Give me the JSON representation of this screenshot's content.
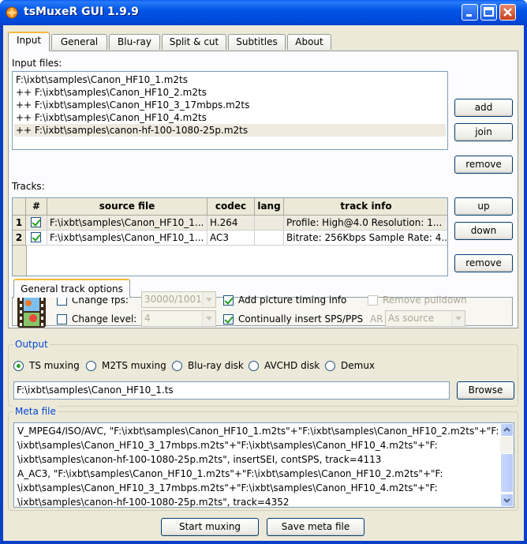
{
  "window": {
    "title": "tsMuxeR GUI 1.9.9"
  },
  "tabs": [
    "Input",
    "General",
    "Blu-ray",
    "Split & cut",
    "Subtitles",
    "About"
  ],
  "input_files": {
    "label": "Input files:",
    "items": [
      "F:\\ixbt\\samples\\Canon_HF10_1.m2ts",
      " ++ F:\\ixbt\\samples\\Canon_HF10_2.m2ts",
      " ++ F:\\ixbt\\samples\\Canon_HF10_3_17mbps.m2ts",
      " ++ F:\\ixbt\\samples\\Canon_HF10_4.m2ts",
      " ++ F:\\ixbt\\samples\\canon-hf-100-1080-25p.m2ts"
    ],
    "buttons": {
      "add": "add",
      "join": "join",
      "remove": "remove"
    }
  },
  "tracks": {
    "label": "Tracks:",
    "columns": [
      "#",
      "source file",
      "codec",
      "lang",
      "track info"
    ],
    "rows": [
      {
        "num": "1",
        "checked": true,
        "source": "F:\\ixbt\\samples\\Canon_HF10_1...",
        "codec": "H.264",
        "lang": "",
        "info": "Profile: High@4.0  Resolution: 1..."
      },
      {
        "num": "2",
        "checked": true,
        "source": "F:\\ixbt\\samples\\Canon_HF10_1...",
        "codec": "AC3",
        "lang": "",
        "info": "Bitrate: 256Kbps Sample Rate: 4..."
      }
    ],
    "buttons": {
      "up": "up",
      "down": "down",
      "remove": "remove"
    }
  },
  "track_options": {
    "tab": "General track options",
    "change_fps": {
      "label": "Change fps:",
      "checked": false,
      "value": "30000/1001"
    },
    "change_level": {
      "label": "Change level:",
      "checked": false,
      "value": "4"
    },
    "add_timing": {
      "label": "Add picture timing info",
      "checked": true
    },
    "insert_sps": {
      "label": "Continually insert SPS/PPS",
      "checked": true
    },
    "remove_pulldown": {
      "label": "Remove pulldown",
      "checked": false
    },
    "ar": {
      "label": "AR",
      "value": "As source"
    }
  },
  "output": {
    "legend": "Output",
    "modes": [
      "TS muxing",
      "M2TS muxing",
      "Blu-ray disk",
      "AVCHD disk",
      "Demux"
    ],
    "selected": "TS muxing",
    "path": "F:\\ixbt\\samples\\Canon_HF10_1.ts",
    "browse": "Browse"
  },
  "meta": {
    "legend": "Meta file",
    "lines": [
      "V_MPEG4/ISO/AVC, \"F:\\ixbt\\samples\\Canon_HF10_1.m2ts\"+\"F:\\ixbt\\samples\\Canon_HF10_2.m2ts\"+\"F:",
      "\\ixbt\\samples\\Canon_HF10_3_17mbps.m2ts\"+\"F:\\ixbt\\samples\\Canon_HF10_4.m2ts\"+\"F:",
      "\\ixbt\\samples\\canon-hf-100-1080-25p.m2ts\", insertSEI, contSPS, track=4113",
      "A_AC3, \"F:\\ixbt\\samples\\Canon_HF10_1.m2ts\"+\"F:\\ixbt\\samples\\Canon_HF10_2.m2ts\"+\"F:",
      "\\ixbt\\samples\\Canon_HF10_3_17mbps.m2ts\"+\"F:\\ixbt\\samples\\Canon_HF10_4.m2ts\"+\"F:",
      "\\ixbt\\samples\\canon-hf-100-1080-25p.m2ts\", track=4352"
    ]
  },
  "footer": {
    "start": "Start muxing",
    "save": "Save meta file"
  }
}
